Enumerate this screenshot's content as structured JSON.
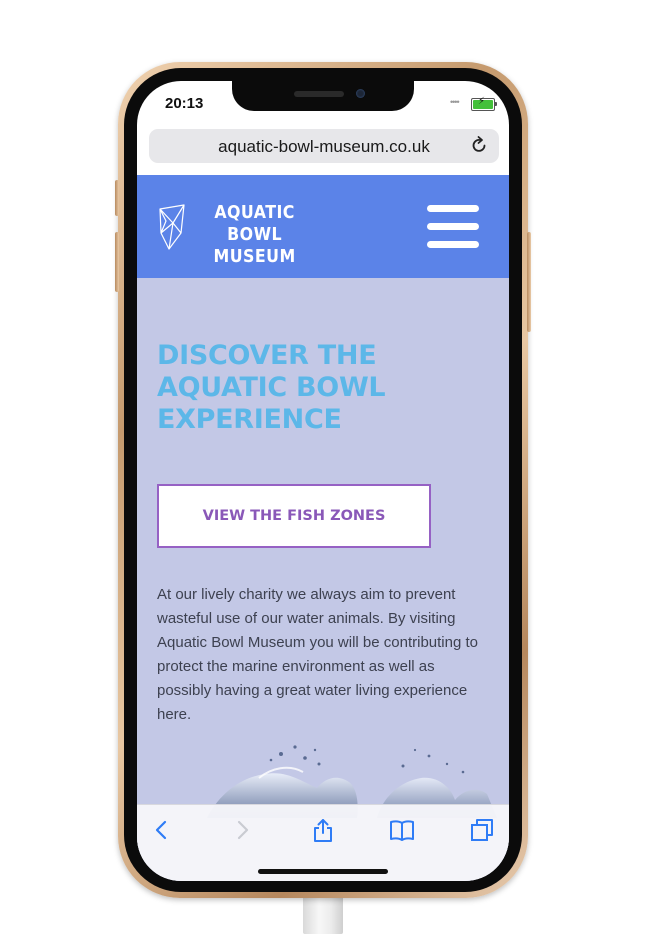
{
  "status_bar": {
    "time": "20:13"
  },
  "browser": {
    "url": "aquatic-bowl-museum.co.uk",
    "toolbar": {
      "back_icon": "chevron-left-icon",
      "forward_icon": "chevron-right-icon",
      "share_icon": "share-icon",
      "bookmarks_icon": "book-icon",
      "tabs_icon": "tabs-icon"
    }
  },
  "site": {
    "header": {
      "logo_line1": "AQUATIC BOWL",
      "logo_line2": "MUSEUM",
      "menu_icon": "hamburger-menu-icon",
      "background_color": "#5b83e8"
    },
    "hero": {
      "title_line1": "DISCOVER THE",
      "title_line2": "AQUATIC BOWL",
      "title_line3": "EXPERIENCE",
      "title_color": "#5cb7e8",
      "cta_label": "VIEW THE FISH ZONES",
      "cta_color": "#8a58b8",
      "intro_text": "At our lively charity we always aim to prevent wasteful use of our water animals. By visiting Aquatic Bowl Museum you will be contributing to protect the marine environment as well as possibly having a great water living experience here.",
      "background_color": "#c3c8e6"
    }
  },
  "device": {
    "frame_color": "#d8b48c"
  }
}
